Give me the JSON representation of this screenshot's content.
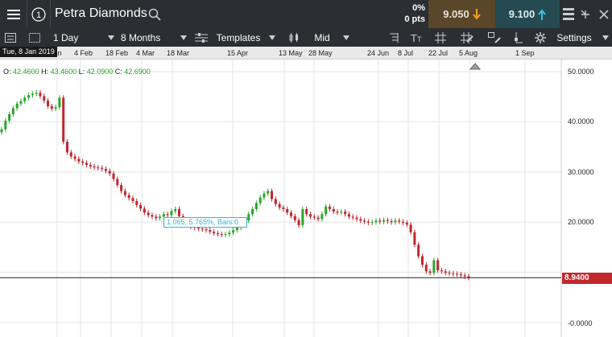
{
  "header": {
    "instrument_name": "Petra Diamonds",
    "change_percent": "0%",
    "change_points": "0 pts",
    "sell_price": "9.050",
    "buy_price": "9.100",
    "sell_bg": "#5a4628",
    "buy_bg": "#254a52",
    "icons": [
      "menu-icon",
      "info-icon",
      "search-icon",
      "layout-icon",
      "minimize-icon",
      "close-icon"
    ]
  },
  "toolbar": {
    "interval": "1 Day",
    "range": "8 Months",
    "templates": "Templates",
    "price_type": "Mid",
    "settings": "Settings"
  },
  "timeline": {
    "cursor_date": "Tue, 8 Jan 2019",
    "labels": [
      "Jan",
      "4 Feb",
      "18 Feb",
      "4 Mar",
      "18 Mar",
      "15 Apr",
      "13 May",
      "28 May",
      "24 Jun",
      "8 Jul",
      "22 Jul",
      "5 Aug",
      "1 Sep"
    ]
  },
  "ohlc": {
    "o_label": "O:",
    "o": "42.4600",
    "h_label": "H:",
    "h": "43.4600",
    "l_label": "L:",
    "l": "42.0900",
    "c_label": "C:",
    "c": "42.6900"
  },
  "measure_annotation": "1.065, 5.765%, Bars:0",
  "current_price_tag": "8.9400",
  "chart_data": {
    "type": "candlestick",
    "y_ticks": [
      "50.0000",
      "40.0000",
      "30.0000",
      "20.0000",
      "-0.0000"
    ],
    "ylim": [
      0,
      53
    ],
    "up_color": "#2aa52a",
    "down_color": "#c1272d",
    "closes": [
      38.5,
      40.2,
      41.5,
      42.7,
      43.6,
      44.1,
      44.8,
      45.3,
      45.6,
      45.8,
      45.1,
      44.2,
      43.1,
      42.6,
      42.9,
      44.8,
      36.0,
      33.9,
      33.1,
      32.6,
      32.1,
      31.8,
      31.4,
      31.1,
      30.9,
      30.8,
      30.6,
      30.2,
      29.7,
      28.6,
      27.4,
      26.2,
      25.4,
      24.8,
      24.2,
      23.4,
      22.7,
      21.9,
      21.4,
      21.1,
      20.8,
      21.1,
      21.6,
      21.4,
      22.2,
      22.6,
      21.2,
      20.4,
      19.6,
      19.1,
      18.9,
      18.7,
      18.6,
      18.4,
      18.1,
      17.8,
      17.6,
      17.5,
      17.6,
      17.9,
      18.4,
      18.9,
      19.4,
      20.3,
      21.6,
      22.6,
      23.8,
      24.9,
      25.7,
      26.2,
      24.6,
      23.6,
      22.9,
      22.6,
      21.9,
      21.2,
      20.4,
      19.4,
      22.6,
      21.6,
      21.1,
      20.9,
      20.6,
      21.6,
      23.1,
      22.6,
      22.1,
      21.9,
      22.1,
      21.6,
      21.1,
      20.9,
      20.6,
      20.3,
      20.1,
      19.9,
      20.0,
      20.3,
      20.1,
      20.4,
      20.2,
      20.0,
      20.3,
      20.1,
      19.9,
      19.5,
      18.0,
      15.5,
      13.2,
      11.5,
      10.2,
      9.9,
      12.4,
      10.4,
      10.2,
      9.9,
      9.8,
      9.7,
      9.6,
      9.4,
      9.2,
      8.94
    ],
    "last_price": 8.94
  }
}
